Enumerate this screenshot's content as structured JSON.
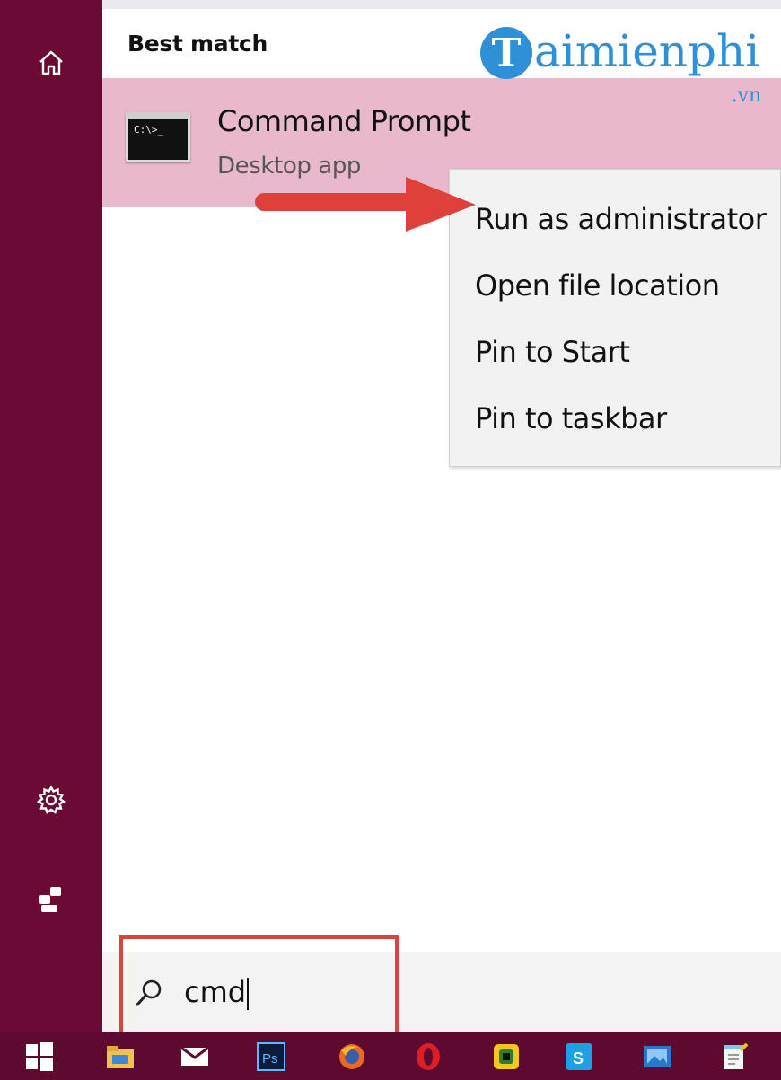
{
  "sidebar": {
    "home_icon": "home-icon",
    "settings_icon": "gear-icon",
    "user_icon": "user-icon",
    "background": "#6b0b34"
  },
  "results": {
    "header": "Best match",
    "item": {
      "title": "Command Prompt",
      "subtitle": "Desktop app",
      "icon": "command-prompt-icon",
      "prompt_text": "C:\\>_"
    },
    "highlight_color": "#e8b8cc"
  },
  "context_menu": {
    "items": [
      "Run as administrator",
      "Open file location",
      "Pin to Start",
      "Pin to taskbar"
    ]
  },
  "annotation": {
    "arrow_color": "#e0403a",
    "box_color": "#d9443e"
  },
  "watermark": {
    "logo_letter": "T",
    "text": "aimienphi",
    "suffix": ".vn"
  },
  "search": {
    "value": "cmd",
    "icon": "search-icon"
  },
  "taskbar": {
    "items": [
      "windows-start-icon",
      "file-explorer-icon",
      "mail-icon",
      "photoshop-icon",
      "firefox-icon",
      "opera-icon",
      "app-icon",
      "skype-icon",
      "photos-icon",
      "notepad-icon"
    ],
    "background": "#5e0a2f",
    "photoshop_label": "Ps"
  }
}
